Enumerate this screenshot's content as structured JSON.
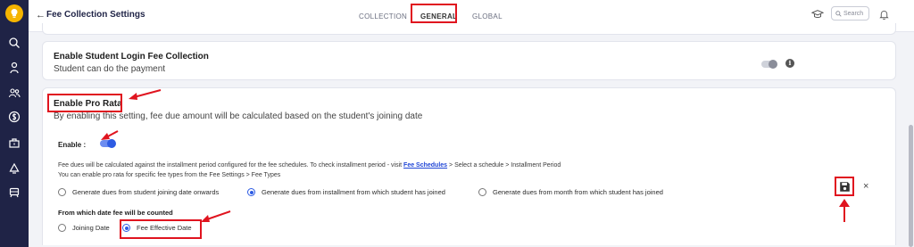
{
  "header": {
    "back_glyph": "←",
    "title": "Fee Collection Settings",
    "tabs": [
      {
        "label": "COLLECTION",
        "active": false
      },
      {
        "label": "GENERAL",
        "active": true
      },
      {
        "label": "GLOBAL",
        "active": false
      }
    ],
    "search_placeholder": "Search"
  },
  "sidebar": {
    "icons": [
      "logo-icon",
      "search-icon",
      "student-icon",
      "users-icon",
      "currency-icon",
      "briefcase-icon",
      "recycle-icon",
      "transport-icon"
    ]
  },
  "student_login_card": {
    "title": "Enable Student Login Fee Collection",
    "subtitle": "Student can do the payment",
    "toggle_on": false,
    "info_glyph": "i"
  },
  "pro_rata_card": {
    "title": "Enable Pro Rata",
    "description": "By enabling this setting, fee due amount will be calculated based on the student's joining date",
    "enable_label": "Enable :",
    "toggle_on": true,
    "note_line1_prefix": "Fee dues will be calculated against the installment period configured for the fee schedules. To check installment period - visit",
    "note_line1_link": "Fee Schedules",
    "note_line1_suffix": "> Select a schedule > Installment Period",
    "note_line2": "You can enable pro rata for specific fee types from the Fee Settings > Fee Types",
    "due_options": [
      {
        "label": "Generate dues from student joining date onwards",
        "checked": false
      },
      {
        "label": "Generate dues from installment from which student has joined",
        "checked": true
      },
      {
        "label": "Generate dues from month from which student has joined",
        "checked": false
      }
    ],
    "from_label": "From which date fee will be counted",
    "date_options": [
      {
        "label": "Joining Date",
        "checked": false
      },
      {
        "label": "Fee Effective Date",
        "checked": true
      }
    ],
    "close_glyph": "×"
  },
  "colors": {
    "sidebar_bg": "#1f2346",
    "accent": "#2d5be3",
    "annotation_red": "#e0141f",
    "link": "#1f45d6"
  }
}
